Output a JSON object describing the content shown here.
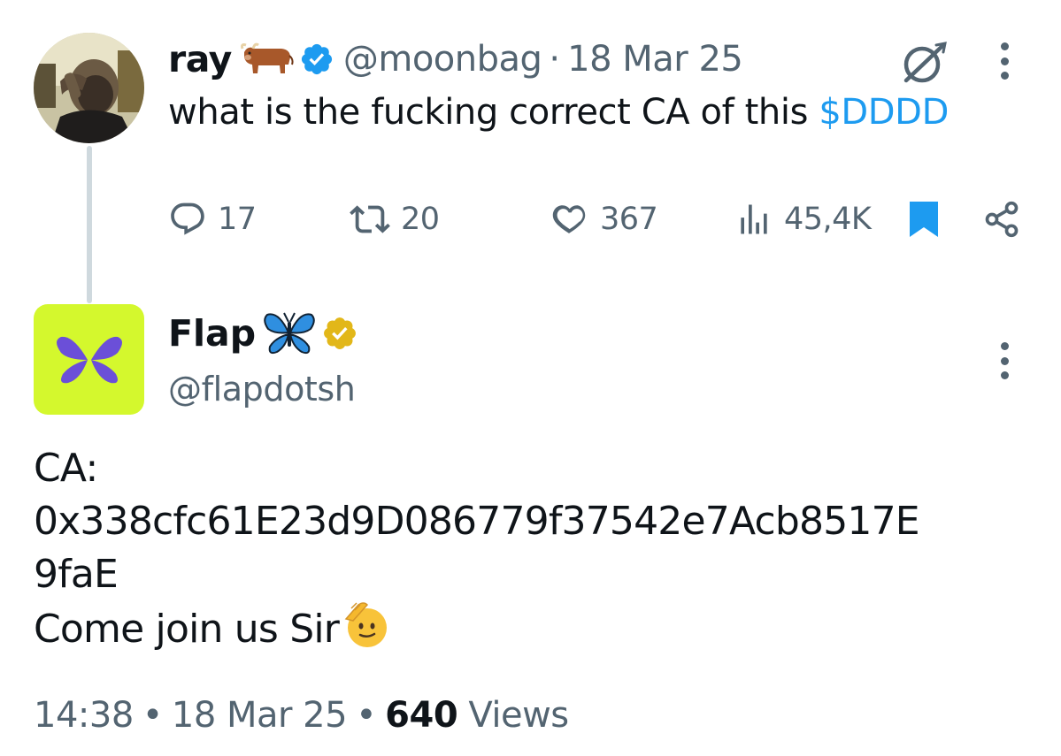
{
  "parent": {
    "name": "ray",
    "name_emoji": "ox-emoji",
    "handle": "@moonbag",
    "separator": "·",
    "date": "18 Mar 25",
    "text": "what is the fucking correct CA of this ",
    "cashtag": "$DDDD",
    "stats": {
      "replies": "17",
      "reposts": "20",
      "likes": "367",
      "views": "45,4K"
    },
    "colors": {
      "link": "#1d9bf0",
      "verified": "#1d9bf0",
      "muted": "#536471"
    }
  },
  "reply": {
    "name": "Flap",
    "name_emoji": "butterfly-emoji",
    "handle": "@flapdotsh",
    "lines": [
      "CA:",
      "0x338cfc61E23d9D086779f37542e7Acb8517E",
      "9faE",
      "Come join us Sir"
    ],
    "trailing_emoji": "saluting-face-emoji",
    "time": "14:38",
    "separator": "•",
    "date": "18 Mar 25",
    "views_count": "640",
    "views_label": " Views",
    "colors": {
      "avatar_bg": "#d4f82d",
      "logo": "#6b4fd8",
      "verified_gold": "#e2b719"
    }
  }
}
